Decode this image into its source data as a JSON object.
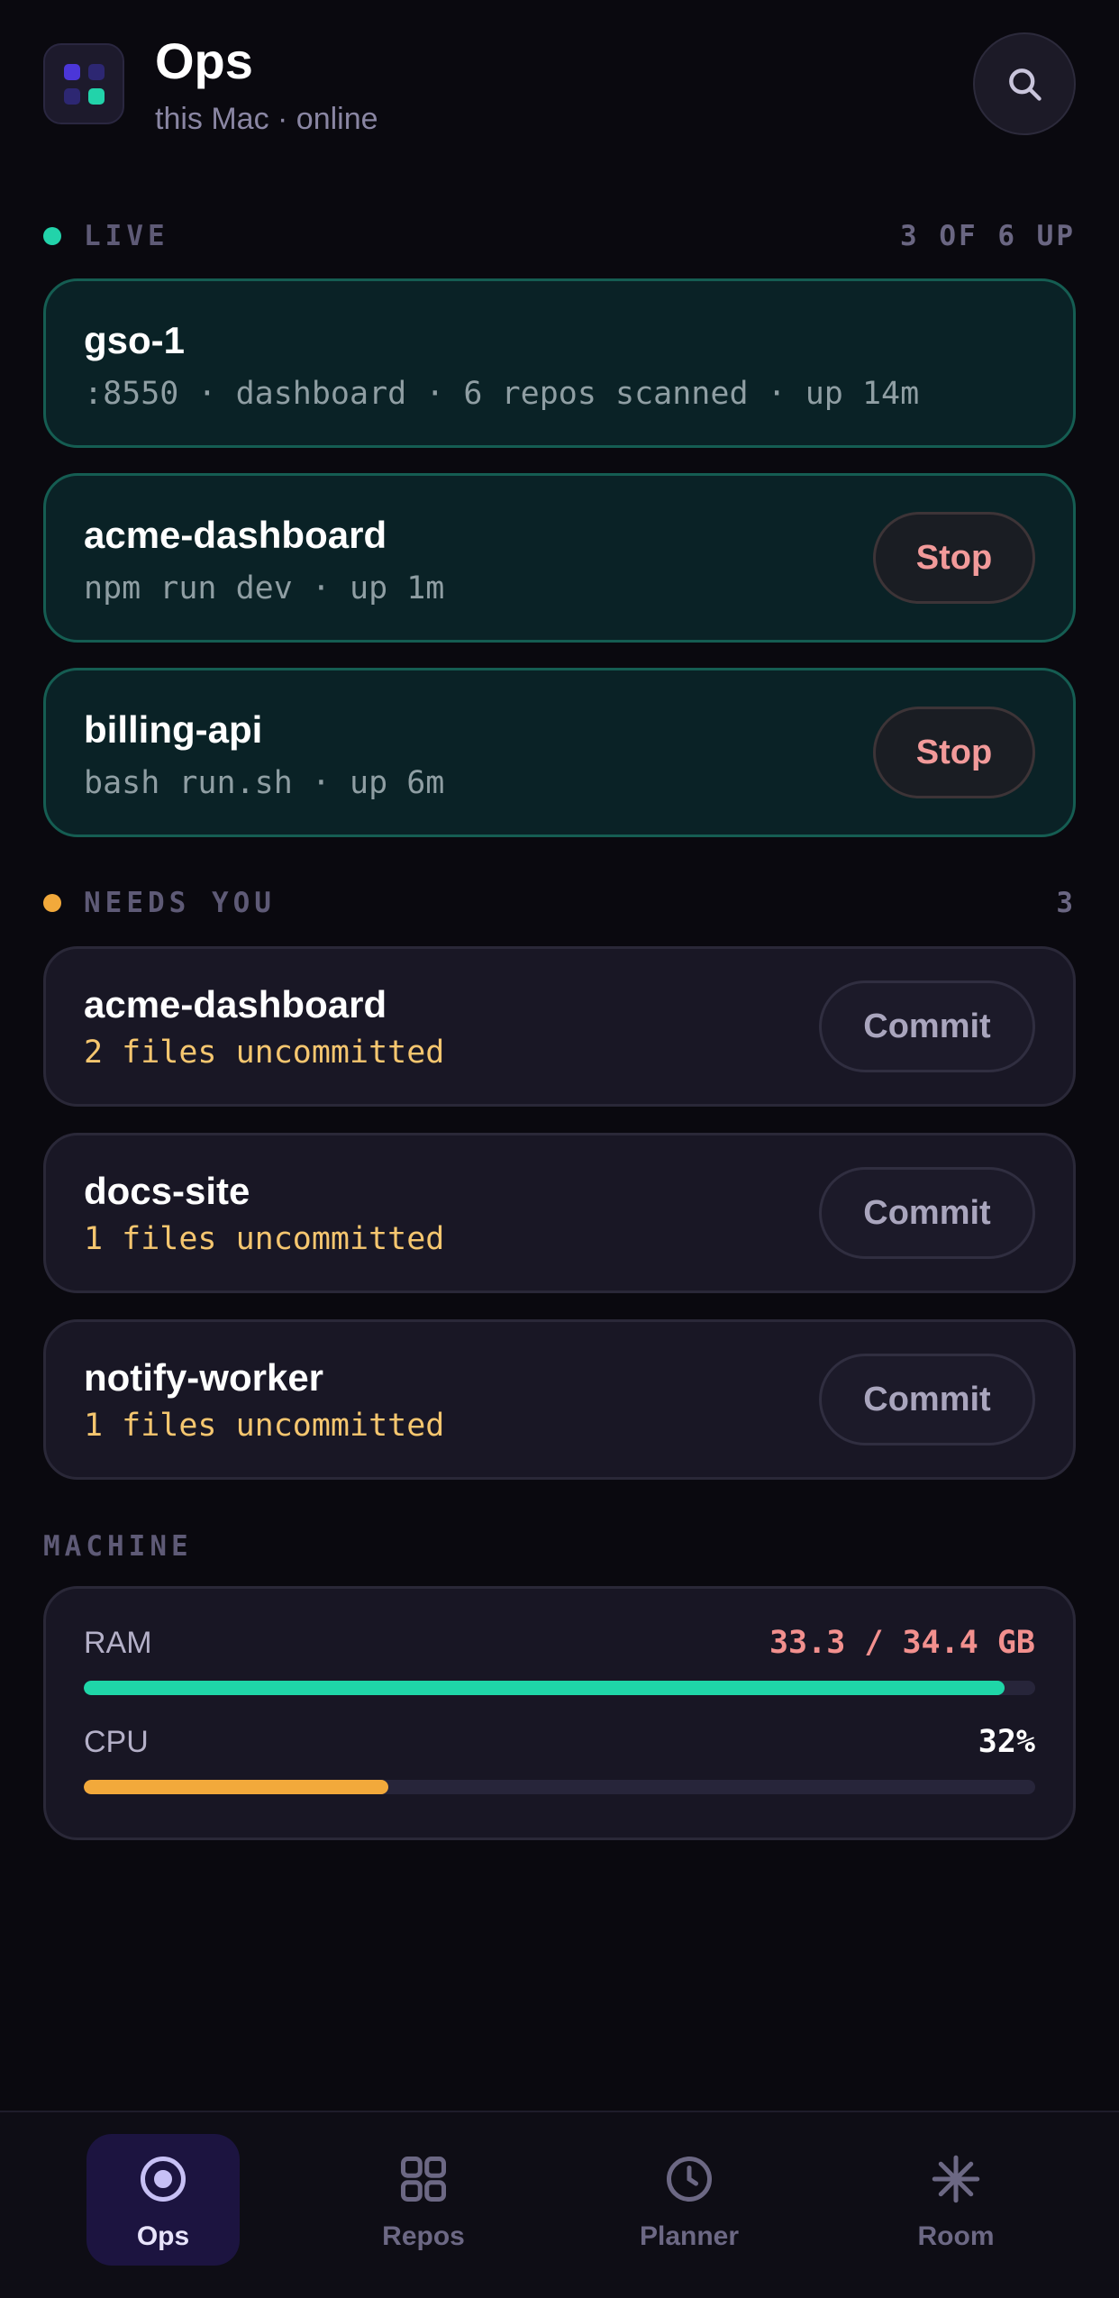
{
  "header": {
    "title": "Ops",
    "subtitle": "this Mac · online",
    "app_icon": "app-grid-icon",
    "search_icon": "search-icon"
  },
  "live": {
    "label": "LIVE",
    "count": "3 OF 6 UP",
    "dot_color": "#22d3aa",
    "items": [
      {
        "title": "gso-1",
        "meta": ":8550 · dashboard · 6 repos scanned · up 14m"
      },
      {
        "title": "acme-dashboard",
        "meta": "npm run dev · up 1m",
        "action": "Stop"
      },
      {
        "title": "billing-api",
        "meta": "bash run.sh · up 6m",
        "action": "Stop"
      }
    ]
  },
  "needs": {
    "label": "NEEDS YOU",
    "count": "3",
    "dot_color": "#f2a93b",
    "items": [
      {
        "title": "acme-dashboard",
        "meta": "2 files uncommitted",
        "action": "Commit"
      },
      {
        "title": "docs-site",
        "meta": "1 files uncommitted",
        "action": "Commit"
      },
      {
        "title": "notify-worker",
        "meta": "1 files uncommitted",
        "action": "Commit"
      }
    ]
  },
  "machine": {
    "label": "MACHINE",
    "ram": {
      "label": "RAM",
      "value": "33.3 / 34.4 GB",
      "used": 33.3,
      "total": 34.4,
      "color": "#1fd6a8",
      "value_color": "#f2908e"
    },
    "cpu": {
      "label": "CPU",
      "value": "32%",
      "percent": 32,
      "color": "#f2a93b",
      "value_color": "#ffffff"
    }
  },
  "nav": {
    "active": "Ops",
    "items": [
      {
        "label": "Ops",
        "icon": "target-icon"
      },
      {
        "label": "Repos",
        "icon": "grid-icon"
      },
      {
        "label": "Planner",
        "icon": "clock-icon"
      },
      {
        "label": "Room",
        "icon": "asterisk-icon"
      }
    ]
  }
}
